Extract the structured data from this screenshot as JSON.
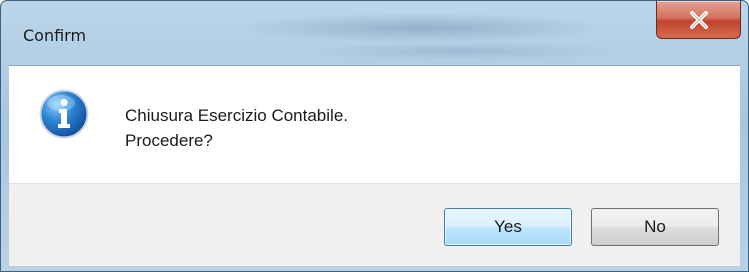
{
  "window": {
    "title": "Confirm"
  },
  "titlebar": {
    "close_icon": "close-icon"
  },
  "message": {
    "icon": "info-icon",
    "line1": "Chiusura Esercizio Contabile.",
    "line2": "Procedere?"
  },
  "buttons": {
    "yes_label": "Yes",
    "no_label": "No"
  },
  "colors": {
    "close_button": "#c0422c",
    "default_button_border": "#3c7fb1",
    "info_icon": "#1f6fc0"
  }
}
